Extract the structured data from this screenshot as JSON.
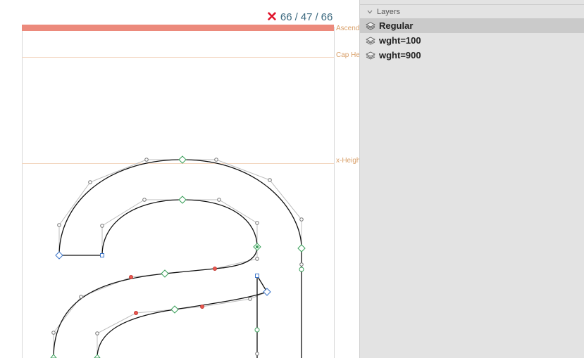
{
  "canvas": {
    "metric_lines": [
      {
        "label": "Ascender"
      },
      {
        "label": "Cap Height"
      },
      {
        "label": "x-Height"
      }
    ],
    "compatibility": {
      "status_icon": "x-mark-icon",
      "status_color": "#e0142b",
      "counts": [
        "66",
        "47",
        "66"
      ],
      "separator": "/"
    },
    "ascender_bar_color": "#ec8a7c"
  },
  "layers_panel": {
    "title": "Layers",
    "layers": [
      {
        "name": "Regular",
        "selected": true,
        "icon": "layer-stack-icon"
      },
      {
        "name": "wght=100",
        "selected": false,
        "icon": "layer-stack-icon"
      },
      {
        "name": "wght=900",
        "selected": false,
        "icon": "layer-stack-icon"
      }
    ]
  }
}
